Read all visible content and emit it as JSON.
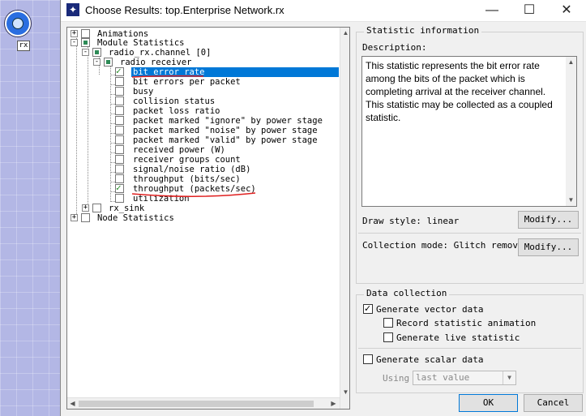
{
  "canvas": {
    "node_label": "rx"
  },
  "window": {
    "title": "Choose Results: top.Enterprise Network.rx",
    "minimize": "—",
    "maximize": "☐",
    "close": "✕"
  },
  "tree": {
    "nodes": [
      {
        "label": "Animations",
        "expander": "+"
      },
      {
        "label": "Module Statistics",
        "expander": "-"
      },
      {
        "label": "radio_rx.channel [0]",
        "expander": "-"
      },
      {
        "label": "radio receiver",
        "expander": "-"
      },
      {
        "label": "bit error rate",
        "checked": true,
        "selected": true
      },
      {
        "label": "bit errors per packet"
      },
      {
        "label": "busy"
      },
      {
        "label": "collision status"
      },
      {
        "label": "packet loss ratio"
      },
      {
        "label": "packet marked \"ignore\" by power stage"
      },
      {
        "label": "packet marked \"noise\" by power stage"
      },
      {
        "label": "packet marked \"valid\" by power stage"
      },
      {
        "label": "received power (W)"
      },
      {
        "label": "receiver groups count"
      },
      {
        "label": "signal/noise ratio (dB)"
      },
      {
        "label": "throughput (bits/sec)"
      },
      {
        "label": "throughput (packets/sec)",
        "checked": true
      },
      {
        "label": "utilization"
      },
      {
        "label": "rx_sink",
        "expander": "+"
      },
      {
        "label": "Node Statistics",
        "expander": "+"
      }
    ],
    "annotation_color": "#e02020"
  },
  "stat_info": {
    "title": "Statistic information",
    "description_label": "Description:",
    "description": "This statistic represents the bit error rate among the bits of the packet which is completing arrival at the receiver channel.\nThis statistic may be collected as a coupled statistic.",
    "draw_style": "Draw style: linear",
    "modify1": "Modify...",
    "collection_mode": "Collection mode: Glitch removal",
    "modify2": "Modify..."
  },
  "data_collection": {
    "title": "Data collection",
    "generate_vector": "Generate vector data",
    "generate_vector_checked": true,
    "record_animation": "Record statistic animation",
    "generate_live": "Generate live statistic",
    "generate_scalar": "Generate scalar data",
    "using_label": "Using",
    "using_value": "last value"
  },
  "buttons": {
    "ok": "OK",
    "cancel": "Cancel"
  }
}
